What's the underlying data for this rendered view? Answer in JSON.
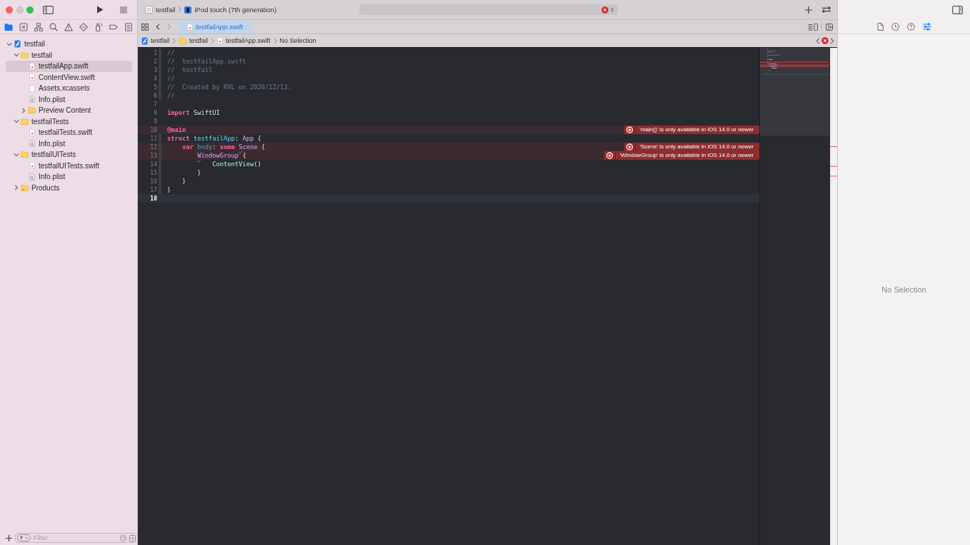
{
  "window": {
    "controls": [
      {
        "kind": "close",
        "disabled": false
      },
      {
        "kind": "minimize",
        "disabled": true
      },
      {
        "kind": "zoom",
        "disabled": false
      }
    ]
  },
  "run_buttons": [
    {
      "kind": "run",
      "disabled": false
    },
    {
      "kind": "stop",
      "disabled": true
    }
  ],
  "toolbar": {
    "scheme": "testfail",
    "destination": "iPod touch (7th generation)",
    "activity": {
      "issues": [
        {
          "kind": "error",
          "count": "3"
        }
      ]
    }
  },
  "navigator": {
    "tabs": [
      {
        "kind": "project",
        "selected": true
      },
      {
        "kind": "source-control",
        "selected": false
      },
      {
        "kind": "symbols",
        "selected": false
      },
      {
        "kind": "find",
        "selected": false
      },
      {
        "kind": "issues",
        "selected": false
      },
      {
        "kind": "tests",
        "selected": false
      },
      {
        "kind": "debug",
        "selected": false
      },
      {
        "kind": "breakpoints",
        "selected": false
      },
      {
        "kind": "reports",
        "selected": false
      }
    ],
    "tree": [
      {
        "label": "testfail",
        "kind": "project",
        "expanded": true,
        "selected": false,
        "children": [
          {
            "label": "testfail",
            "kind": "folder",
            "expanded": true,
            "selected": false,
            "children": [
              {
                "label": "testfailApp.swift",
                "kind": "swift",
                "selected": true
              },
              {
                "label": "ContentView.swift",
                "kind": "swift",
                "selected": false
              },
              {
                "label": "Assets.xcassets",
                "kind": "assets",
                "selected": false
              },
              {
                "label": "Info.plist",
                "kind": "plist",
                "selected": false
              },
              {
                "label": "Preview Content",
                "kind": "folder",
                "expanded": false,
                "selected": false
              }
            ]
          },
          {
            "label": "testfailTests",
            "kind": "folder",
            "expanded": true,
            "selected": false,
            "children": [
              {
                "label": "testfailTests.swift",
                "kind": "swift",
                "selected": false
              },
              {
                "label": "Info.plist",
                "kind": "plist",
                "selected": false
              }
            ]
          },
          {
            "label": "testfailUITests",
            "kind": "folder",
            "expanded": true,
            "selected": false,
            "children": [
              {
                "label": "testfailUITests.swift",
                "kind": "swift",
                "selected": false
              },
              {
                "label": "Info.plist",
                "kind": "plist",
                "selected": false
              }
            ]
          },
          {
            "label": "Products",
            "kind": "products",
            "expanded": false,
            "selected": false
          }
        ]
      }
    ],
    "filter": {
      "placeholder": "Filter"
    }
  },
  "editor": {
    "nav_buttons": [
      {
        "kind": "back",
        "disabled": false
      },
      {
        "kind": "forward",
        "disabled": true
      }
    ],
    "tabs": [
      {
        "kind": "swift",
        "label": "testfailApp.swift",
        "selected": true,
        "preview": true
      }
    ],
    "breadcrumb": [
      {
        "kind": "project",
        "label": "testfail"
      },
      {
        "kind": "folder",
        "label": "testfail"
      },
      {
        "kind": "swift",
        "label": "testfailApp.swift"
      },
      {
        "kind": "selection",
        "label": "No Selection"
      }
    ],
    "issue_nav": {
      "kind": "error"
    },
    "lines": [
      {
        "number": "1",
        "current": false,
        "fold": true,
        "squiggle": false,
        "tokens": [
          {
            "kind": "comment",
            "text": "//"
          }
        ]
      },
      {
        "number": "2",
        "current": false,
        "fold": true,
        "squiggle": false,
        "tokens": [
          {
            "kind": "comment",
            "text": "//  testfailApp.swift"
          }
        ]
      },
      {
        "number": "3",
        "current": false,
        "fold": true,
        "squiggle": false,
        "tokens": [
          {
            "kind": "comment",
            "text": "//  testfail"
          }
        ]
      },
      {
        "number": "4",
        "current": false,
        "fold": true,
        "squiggle": false,
        "tokens": [
          {
            "kind": "comment",
            "text": "//"
          }
        ]
      },
      {
        "number": "5",
        "current": false,
        "fold": true,
        "squiggle": false,
        "tokens": [
          {
            "kind": "comment",
            "text": "//  Created by RVL on 2020/12/13."
          }
        ]
      },
      {
        "number": "6",
        "current": false,
        "fold": true,
        "squiggle": false,
        "tokens": [
          {
            "kind": "comment",
            "text": "//"
          }
        ]
      },
      {
        "number": "7",
        "current": false,
        "fold": false,
        "squiggle": false
      },
      {
        "number": "8",
        "current": false,
        "fold": false,
        "squiggle": false,
        "tokens": [
          {
            "kind": "keyword",
            "text": "import "
          },
          {
            "kind": "plain",
            "text": "SwiftUI"
          }
        ]
      },
      {
        "number": "9",
        "current": false,
        "fold": false,
        "squiggle": false
      },
      {
        "number": "10",
        "current": false,
        "fold": false,
        "squiggle": false,
        "tokens": [
          {
            "kind": "keyword",
            "text": "@main"
          }
        ],
        "error": "'main()' is only available in iOS 14.0 or newer"
      },
      {
        "number": "11",
        "current": false,
        "fold": true,
        "squiggle": false,
        "tokens": [
          {
            "kind": "keyword",
            "text": "struct "
          },
          {
            "kind": "type_decl",
            "text": "testfailApp"
          },
          {
            "kind": "plain",
            "text": ": "
          },
          {
            "kind": "type",
            "text": "App"
          },
          {
            "kind": "plain",
            "text": " {"
          }
        ]
      },
      {
        "number": "12",
        "current": false,
        "fold": true,
        "squiggle": true,
        "tokens": [
          {
            "kind": "keyword",
            "text": "    var "
          },
          {
            "kind": "property",
            "text": "body"
          },
          {
            "kind": "plain",
            "text": ": "
          },
          {
            "kind": "keyword",
            "text": "some "
          },
          {
            "kind": "type",
            "text": "Scene"
          },
          {
            "kind": "plain",
            "text": " {"
          }
        ],
        "error": "'Scene' is only available in iOS 14.0 or newer"
      },
      {
        "number": "13",
        "current": false,
        "fold": true,
        "squiggle": true,
        "tokens": [
          {
            "kind": "type",
            "text": "        WindowGroup"
          },
          {
            "kind": "plain",
            "text": " {"
          }
        ],
        "error": "'WindowGroup' is only available in iOS 14.0 or newer"
      },
      {
        "number": "14",
        "current": false,
        "fold": true,
        "squiggle": false,
        "tokens": [
          {
            "kind": "project_type",
            "text": "            ContentView"
          },
          {
            "kind": "plain",
            "text": "()"
          }
        ]
      },
      {
        "number": "15",
        "current": false,
        "fold": true,
        "squiggle": false,
        "tokens": [
          {
            "kind": "plain",
            "text": "        }"
          }
        ]
      },
      {
        "number": "16",
        "current": false,
        "fold": true,
        "squiggle": false,
        "tokens": [
          {
            "kind": "plain",
            "text": "    }"
          }
        ]
      },
      {
        "number": "17",
        "current": false,
        "fold": true,
        "squiggle": false,
        "tokens": [
          {
            "kind": "plain",
            "text": "}"
          }
        ]
      },
      {
        "number": "18",
        "current": true,
        "fold": false,
        "squiggle": false
      }
    ]
  },
  "inspector": {
    "tabs": [
      {
        "kind": "file",
        "selected": false
      },
      {
        "kind": "history",
        "selected": false
      },
      {
        "kind": "help",
        "selected": false
      },
      {
        "kind": "attributes",
        "selected": true
      }
    ],
    "message": "No Selection"
  }
}
